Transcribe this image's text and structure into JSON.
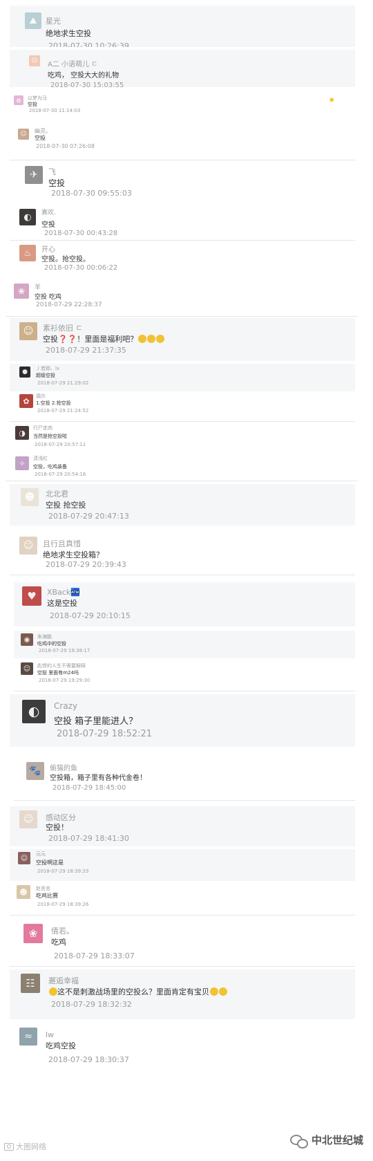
{
  "comments": [
    {
      "name": "星光",
      "text": "绝地求生空投",
      "time": "2018-07-30 10:26:39",
      "avatar_icon": "landscape-avatar",
      "avatar_color": "#b9cfd6"
    },
    {
      "name": "A二 小语萌儿 ㄷ",
      "text": "吃鸡，  空投大大的礼物",
      "time": "2018-07-30 15:03:55",
      "avatar_icon": "cartoon-avatar",
      "avatar_color": "#f2c9b5"
    },
    {
      "name": "以梦为马",
      "text": "空投",
      "time": "2018-07-30 11:14:03",
      "avatar_icon": "pink-flower-avatar",
      "avatar_color": "#e3b6d8",
      "star_icon": "star-icon"
    },
    {
      "name": "幽灵。",
      "text": "空投",
      "time": "2018-07-30 07:26:08",
      "avatar_icon": "girl-avatar",
      "avatar_color": "#caa892"
    },
    {
      "name": "飞",
      "text": "空投",
      "time": "2018-07-30 09:55:03",
      "avatar_icon": "plane-avatar",
      "avatar_color": "#8f8f8f"
    },
    {
      "name": "寡欢.",
      "text": "空投",
      "time": "2018-07-30 00:43:28",
      "avatar_icon": "dark-avatar",
      "avatar_color": "#3e3a3a"
    },
    {
      "name": "开心",
      "text": "空投。抢空投。",
      "time": "2018-07-30 00:06:22",
      "avatar_icon": "drink-avatar",
      "avatar_color": "#d99a84"
    },
    {
      "name": "羊",
      "text": "空投 吃鸡",
      "time": "2018-07-29 22:28:37",
      "avatar_icon": "pink-avatar",
      "avatar_color": "#d5a6c4"
    },
    {
      "name": "素衫依旧 ㄷ",
      "text": "空投",
      "question_marks": "❓❓",
      "text_after": "！里面是福利吧？",
      "emoji_count": 3,
      "time": "2018-07-29 21:37:35",
      "avatar_icon": "portrait-avatar",
      "avatar_color": "#cdb08a"
    },
    {
      "name": "丿若即、lx",
      "text": "超级空投",
      "time": "2018-07-29 21:29:02",
      "avatar_icon": "black-hair-avatar",
      "avatar_color": "#2b2b2b"
    },
    {
      "name": "偶尔",
      "text": "1.空投 2.抢空投",
      "time": "2018-07-29 21:24:52",
      "avatar_icon": "rose-avatar",
      "avatar_color": "#b5453c"
    },
    {
      "name": "行尸走肉",
      "text": "当然是抢空投啦",
      "time": "2018-07-29 20:57:11",
      "avatar_icon": "shadow-avatar",
      "avatar_color": "#4a3b38"
    },
    {
      "name": "清浅红",
      "text": "空投，吃鸡装备",
      "time": "2018-07-29 20:54:16",
      "avatar_icon": "anime-avatar",
      "avatar_color": "#c4a1c9"
    },
    {
      "name": "北北君",
      "text": "空投 抢空投",
      "time": "2018-07-29 20:47:13",
      "avatar_icon": "cartoon-face-avatar",
      "avatar_color": "#e9e4d8"
    },
    {
      "name": "且行且真惜",
      "text": "绝地求生空投箱？",
      "time": "2018-07-29 20:39:43",
      "avatar_icon": "doll-avatar",
      "avatar_color": "#e2d2c2"
    },
    {
      "name": "XBack🏧",
      "text": "这是空投",
      "time": "2018-07-29 20:10:15",
      "avatar_icon": "red-avatar",
      "avatar_color": "#c04c4c"
    },
    {
      "name": "朱海鹏",
      "text": "吃鸡中的空投",
      "time": "2018-07-29 19:38:17",
      "avatar_icon": "brown-avatar",
      "avatar_color": "#7a5a4a"
    },
    {
      "name": "彪悍的人生不需要解释",
      "text": "空投 里面有m24吗",
      "time": "2018-07-29 19:29:30",
      "avatar_icon": "face-avatar",
      "avatar_color": "#5b4a44"
    },
    {
      "name": "Crazy",
      "text": "空投 箱子里能进人？",
      "time": "2018-07-29 18:52:21",
      "avatar_icon": "dark-photo-avatar",
      "avatar_color": "#3c3c3c"
    },
    {
      "name": "偷猫的鱼",
      "text": "空投箱，箱子里有各种代金卷！",
      "time": "2018-07-29 18:45:00",
      "avatar_icon": "cat-avatar",
      "avatar_color": "#b8aaa0"
    },
    {
      "name": "感动区分",
      "text": "空投！",
      "time": "2018-07-29 18:41:30",
      "avatar_icon": "baby-avatar",
      "avatar_color": "#e6d8cc"
    },
    {
      "name": "元元",
      "text": "空投啊这是",
      "time": "2018-07-29 18:39:33",
      "avatar_icon": "girl-photo-avatar",
      "avatar_color": "#8a5f5f"
    },
    {
      "name": "赵言言",
      "text": "吃鸡比赛",
      "time": "2018-07-29 18:39:26",
      "avatar_icon": "cartoon-girl-avatar",
      "avatar_color": "#d9c7a8"
    },
    {
      "name": "倩若。",
      "text": "吃鸡",
      "time": "2018-07-29 18:33:07",
      "avatar_icon": "pink-girl-avatar",
      "avatar_color": "#e27a9e"
    },
    {
      "name": "邂逅幸福",
      "emoji_before": true,
      "text": "这不是刺激战场里的空投么？里面肯定有宝贝",
      "emoji_count": 2,
      "time": "2018-07-29 18:32:32",
      "avatar_icon": "group-photo-avatar",
      "avatar_color": "#8c8070"
    },
    {
      "name": "lw",
      "text": "吃鸡空投",
      "time": "2018-07-29 18:30:37",
      "avatar_icon": "sea-avatar",
      "avatar_color": "#8fa3ad"
    }
  ],
  "footer": {
    "left_text": "大图网络",
    "right_text": "中北世纪城",
    "left_icon": "camera-icon",
    "right_icon": "wechat-icon"
  }
}
